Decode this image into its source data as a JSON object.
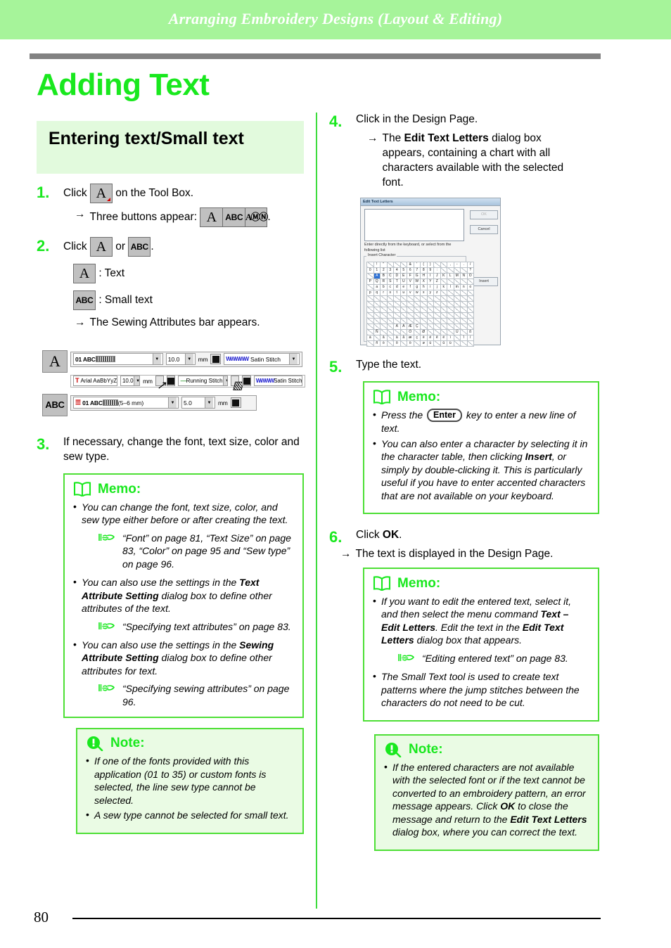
{
  "page": {
    "running_header": "Arranging Embroidery Designs (Layout & Editing)",
    "chapter_title": "Adding Text",
    "page_number": "80",
    "accent_green": "#19e81e",
    "header_band_color": "#a6f49a",
    "section_band_color": "#e2fadd",
    "note_bg_color": "#eafbe4"
  },
  "section": {
    "title": "Entering text/Small text"
  },
  "steps": {
    "s1": {
      "num": "1.",
      "lead": "Click",
      "tail": "on the Tool Box.",
      "arrow": "→",
      "sub_lead": "Three buttons appear:",
      "sub_tail": ".",
      "buttons": [
        "A",
        "ABC",
        "AⒷⒸ"
      ]
    },
    "s2": {
      "num": "2.",
      "lead": "Click",
      "mid": "or",
      "tail": ".",
      "legend": [
        {
          "icon": "A",
          "label": ": Text"
        },
        {
          "icon": "ABC",
          "label": ": Small text"
        }
      ],
      "arrow": "→",
      "sub_text": "The Sewing Attributes bar appears."
    },
    "s3": {
      "num": "3.",
      "text": "If necessary, change the font, text size, color and sew type."
    },
    "s4": {
      "num": "4.",
      "text": "Click in the Design Page.",
      "arrow": "→",
      "sub_pre": "The ",
      "sub_bold": "Edit Text Letters",
      "sub_post": " dialog box appears, containing a chart with all characters available with the selected font."
    },
    "s5": {
      "num": "5.",
      "text": "Type the text."
    },
    "s6": {
      "num": "6.",
      "pre": "Click ",
      "bold": "OK",
      "post": ".",
      "arrow": "→",
      "sub_text": "The text is displayed in the Design Page."
    }
  },
  "attr_bar_figure": {
    "row_text_icon": "A",
    "row_small_icon": "ABC",
    "row1": {
      "font_value": "01 ABC",
      "size_value": "10.0",
      "unit": "mm",
      "sew_value": "Satin Stitch"
    },
    "row2": {
      "font_value": "Arial  AaBbYyZz",
      "size_value": "10.0",
      "unit": "mm",
      "line_sew_value": "Running Stitch",
      "region_sew_value": "Satin Stitch"
    },
    "row3": {
      "font_value": "01 ABC",
      "font_suffix": "(5–6 mm)",
      "size_value": "5.0",
      "unit": "mm"
    }
  },
  "dialog": {
    "title": "Edit Text Letters",
    "textarea_value": "",
    "ok_label": "OK",
    "cancel_label": "Cancel",
    "insert_label": "Insert",
    "hint": "Enter directly from the keyboard, or select from the following list",
    "group_label": "Insert Character",
    "selected_char": "A",
    "grid_rows": [
      [
        "",
        "!",
        "\"",
        "",
        "",
        "",
        "&",
        "'",
        "(",
        ")",
        "",
        "",
        ",",
        "-",
        ".",
        "/"
      ],
      [
        "0",
        "1",
        "2",
        "3",
        "4",
        "5",
        "6",
        "7",
        "8",
        "9",
        ":",
        "",
        "",
        "",
        "",
        "?"
      ],
      [
        "",
        "A",
        "B",
        "C",
        "D",
        "E",
        "F",
        "G",
        "H",
        "I",
        "J",
        "K",
        "L",
        "M",
        "N",
        "O"
      ],
      [
        "P",
        "Q",
        "R",
        "S",
        "T",
        "U",
        "V",
        "W",
        "X",
        "Y",
        "Z",
        "",
        "",
        "",
        "",
        ""
      ],
      [
        "",
        "a",
        "b",
        "c",
        "d",
        "e",
        "f",
        "g",
        "h",
        "i",
        "j",
        "k",
        "l",
        "m",
        "n",
        "o"
      ],
      [
        "p",
        "q",
        "r",
        "s",
        "t",
        "u",
        "v",
        "w",
        "x",
        "y",
        "z",
        "",
        "",
        "",
        "",
        ""
      ],
      [
        "",
        "",
        "",
        "",
        "",
        "",
        "",
        "",
        "",
        "",
        "",
        "",
        "",
        "",
        "",
        ""
      ],
      [
        "",
        "",
        "",
        "",
        "",
        "",
        "",
        "",
        "",
        "",
        "",
        "",
        "",
        "",
        "",
        ""
      ],
      [
        "",
        "",
        "",
        "",
        "",
        "",
        "",
        "",
        "",
        "",
        "",
        "",
        "",
        "",
        "",
        ""
      ],
      [
        "",
        "",
        "",
        "",
        "",
        "",
        "",
        "",
        "",
        "",
        "",
        "",
        "",
        "",
        "",
        ""
      ],
      [
        "",
        "",
        "",
        "",
        "",
        "",
        "",
        "",
        "",
        "",
        "",
        "",
        "",
        "",
        "",
        ""
      ],
      [
        "",
        "",
        "",
        "",
        "À",
        "Á",
        "Æ",
        "Ç",
        "",
        "",
        "",
        "",
        "",
        "",
        "",
        ""
      ],
      [
        "",
        "Ñ",
        "",
        "",
        "",
        "",
        "Ó",
        "",
        "Ø",
        "",
        "",
        "",
        "",
        "Ü",
        "",
        "ß"
      ],
      [
        "à",
        "",
        "â",
        "",
        "ä",
        "å",
        "æ",
        "ç",
        "è",
        "é",
        "ê",
        "ë",
        "ì",
        "",
        "î",
        "ï"
      ],
      [
        "",
        "ñ",
        "ò",
        "",
        "ô",
        "",
        "ö",
        "",
        "ø",
        "ù",
        "",
        "û",
        "ü",
        "",
        "",
        ""
      ]
    ]
  },
  "memo_left": {
    "head": "Memo:",
    "bullets": [
      {
        "pre": "You can change the font, text size, color, and sew type either before or after creating the text.",
        "bold": "",
        "post": ""
      },
      {
        "pre": "You can also use the settings in the ",
        "bold": "Text Attribute Setting",
        "post": " dialog box to define other attributes of the text."
      },
      {
        "pre": "You can also use the settings in the ",
        "bold": "Sewing Attribute Setting",
        "post": " dialog box to define other attributes for text."
      }
    ],
    "refs": [
      "“Font” on page 81, “Text Size” on page 83, “Color” on page 95 and “Sew type” on page 96.",
      "“Specifying text attributes” on page 83.",
      "“Specifying sewing attributes” on page 96."
    ]
  },
  "note_left": {
    "head": "Note:",
    "bullets": [
      "If one of the fonts provided with this application (01 to 35) or custom fonts is selected, the line sew type cannot be selected.",
      "A sew type cannot be selected for small text."
    ]
  },
  "memo_right_1": {
    "head": "Memo:",
    "b1_pre": "Press the ",
    "b1_key": "Enter",
    "b1_post": " key to enter a new line of text.",
    "b2_pre": "You can also enter a character by selecting it in the character table, then clicking ",
    "b2_bold": "Insert",
    "b2_post": ", or simply by double-clicking it. This is particularly useful if you have to enter accented characters that are not available on your keyboard."
  },
  "memo_right_2": {
    "head": "Memo:",
    "b1_pre": "If you want to edit the entered text, select it, and then select the menu command ",
    "b1_bold1": "Text – Edit Letters",
    "b1_mid": ". Edit the text in the ",
    "b1_bold2": "Edit Text Letters",
    "b1_post": " dialog box that appears.",
    "ref": "“Editing entered text” on page 83.",
    "b2": "The Small Text tool is used to create text patterns where the jump stitches between the characters do not need to be cut."
  },
  "note_right": {
    "head": "Note:",
    "b1_pre": "If the entered characters are not available with the selected font or if the text cannot be converted to an embroidery pattern, an error message appears. Click ",
    "b1_bold1": "OK",
    "b1_mid": " to close the message and return to the ",
    "b1_bold2": "Edit Text Letters",
    "b1_post": " dialog box, where you can correct the text."
  }
}
